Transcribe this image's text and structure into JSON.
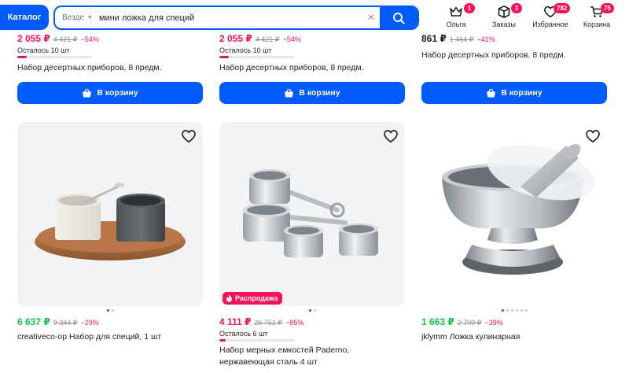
{
  "header": {
    "catalog_label": "Каталог",
    "search": {
      "scope": "Везде",
      "query": "мини ложка для специй"
    },
    "nav": [
      {
        "label": "Ольга",
        "badge": "1"
      },
      {
        "label": "Заказы",
        "badge": "3"
      },
      {
        "label": "Избранное",
        "badge": "782"
      },
      {
        "label": "Корзина",
        "badge": "75"
      }
    ]
  },
  "top_cards": [
    {
      "price": "2 055 ₽",
      "old_price": "4 421 ₽",
      "discount": "−54%",
      "stock": "Осталось 10 шт",
      "stock_level": 0.12,
      "title": "Набор десертных приборов, 8 предм.",
      "button": "В корзину"
    },
    {
      "price": "2 055 ₽",
      "old_price": "4 421 ₽",
      "discount": "−54%",
      "stock": "Осталось 10 шт",
      "stock_level": 0.12,
      "title": "Набор десертных приборов, 8 предм.",
      "button": "В корзину"
    },
    {
      "price": "861 ₽",
      "old_price": "1 464 ₽",
      "discount": "−41%",
      "title": "Набор десертных приборов, 8 предм.",
      "button": "В корзину"
    }
  ],
  "bottom_cards": [
    {
      "price": "6 637 ₽",
      "old_price": "9 344 ₽",
      "discount": "−29%",
      "title": "creativeco-op Набор для специй, 1 шт"
    },
    {
      "sale_badge": "Распродажа",
      "price": "4 111 ₽",
      "old_price": "26 751 ₽",
      "discount": "−85%",
      "stock": "Осталось 6 шт",
      "stock_level": 0.08,
      "title": "Набор мерных емкостей Paderno, нержавеющая сталь 4 шт"
    },
    {
      "price": "1 663 ₽",
      "old_price": "2 709 ₽",
      "discount": "−39%",
      "title": "jklymm Ложка кулинарная"
    }
  ],
  "colors": {
    "accent": "#005bff",
    "sale": "#f91155",
    "green_price": "#10c44c"
  }
}
